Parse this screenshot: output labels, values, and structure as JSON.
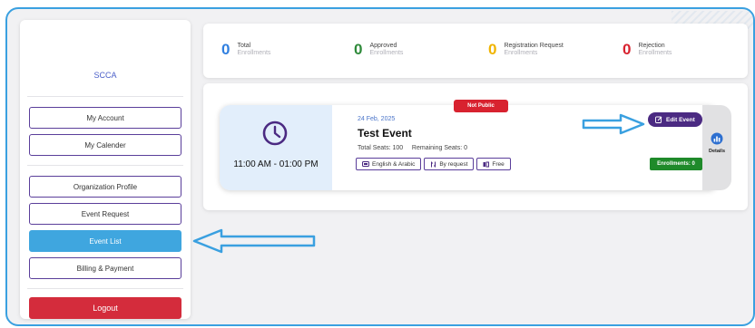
{
  "sidebar": {
    "org_name": "SCCA",
    "items": [
      {
        "label": "My Account"
      },
      {
        "label": "My Calender"
      },
      {
        "label": "Organization Profile"
      },
      {
        "label": "Event Request"
      },
      {
        "label": "Event List"
      },
      {
        "label": "Billing & Payment"
      }
    ],
    "logout_label": "Logout"
  },
  "stats": [
    {
      "value": "0",
      "label": "Total",
      "sub": "Enrollments",
      "color": "#2f7fe0"
    },
    {
      "value": "0",
      "label": "Approved",
      "sub": "Enrollments",
      "color": "#2e8a3a"
    },
    {
      "value": "0",
      "label": "Registration Request",
      "sub": "Enrollments",
      "color": "#f0b400"
    },
    {
      "value": "0",
      "label": "Rejection",
      "sub": "Enrollments",
      "color": "#d8222f"
    }
  ],
  "event": {
    "time": "11:00 AM - 01:00 PM",
    "date": "24 Feb, 2025",
    "title": "Test Event",
    "seats": "Total Seats: 100     Remaining Seats: 0",
    "status_badge": "Not Public",
    "edit_label": "Edit Event",
    "enrollments_label": "Enrollments: 0",
    "details_label": "Details",
    "chips": [
      {
        "label": "English & Arabic",
        "icon": "language-icon"
      },
      {
        "label": "By request",
        "icon": "request-icon"
      },
      {
        "label": "Free",
        "icon": "ticket-icon"
      }
    ]
  },
  "colors": {
    "accent_purple": "#4b2a82",
    "active_blue": "#3fa6df",
    "logout_red": "#d42c3c",
    "arrow_blue": "#3aa0e0"
  }
}
